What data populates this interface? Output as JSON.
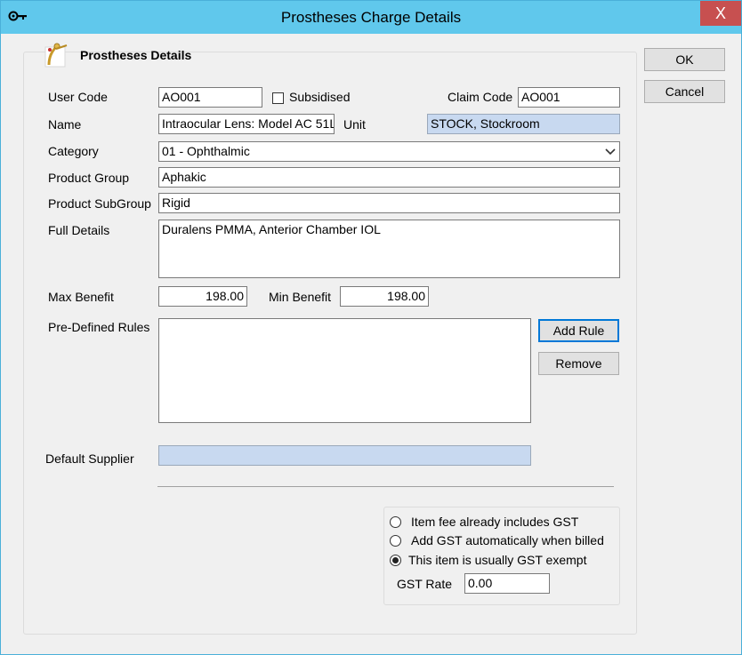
{
  "window": {
    "title": "Prostheses Charge Details",
    "close_glyph": "X"
  },
  "header": {
    "section_title": "Prostheses Details"
  },
  "buttons": {
    "ok": "OK",
    "cancel": "Cancel",
    "add_rule": "Add Rule",
    "remove": "Remove"
  },
  "form": {
    "user_code_label": "User Code",
    "user_code": "AO001",
    "subsidised_label": "Subsidised",
    "subsidised_checked": false,
    "claim_code_label": "Claim Code",
    "claim_code": "AO001",
    "name_label": "Name",
    "name": "Intraocular Lens: Model  AC 51L",
    "unit_label": "Unit",
    "unit": "STOCK, Stockroom",
    "category_label": "Category",
    "category": "01 - Ophthalmic",
    "product_group_label": "Product Group",
    "product_group": "Aphakic",
    "product_subgroup_label": "Product SubGroup",
    "product_subgroup": "Rigid",
    "full_details_label": "Full Details",
    "full_details": "Duralens  PMMA, Anterior Chamber IOL",
    "max_benefit_label": "Max Benefit",
    "max_benefit": "198.00",
    "min_benefit_label": "Min Benefit",
    "min_benefit": "198.00",
    "rules_label": "Pre-Defined Rules",
    "rules": [],
    "default_supplier_label": "Default Supplier",
    "default_supplier": ""
  },
  "gst": {
    "options": [
      {
        "label": "Item fee already includes GST",
        "selected": false
      },
      {
        "label": "Add GST automatically when billed",
        "selected": false
      },
      {
        "label": "This item is usually GST exempt",
        "selected": true
      }
    ],
    "rate_label": "GST Rate",
    "rate": "0.00"
  },
  "icons": {
    "system": "key-icon",
    "section": "prosthesis-icon",
    "dropdown": "chevron-down-icon"
  },
  "colors": {
    "titlebar": "#60c8ec",
    "close_button": "#c75050",
    "readonly_field": "#c8d9f0"
  }
}
